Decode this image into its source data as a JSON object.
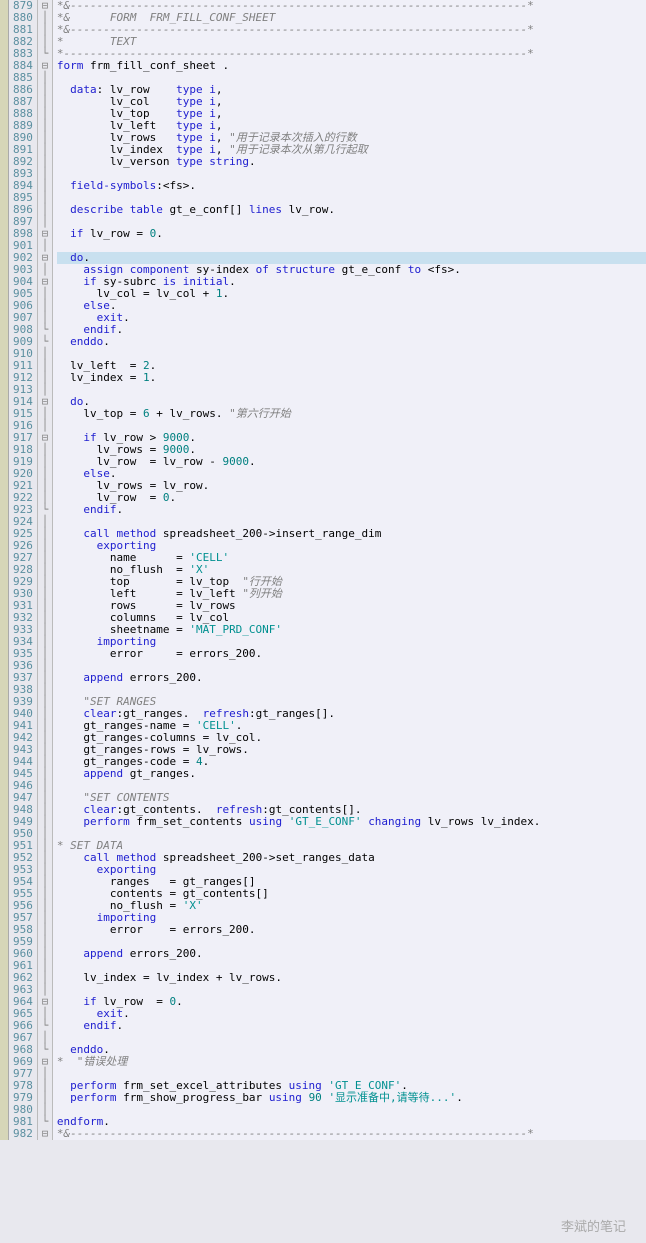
{
  "lines": [
    {
      "n": 879,
      "f": "⊟",
      "cls": "cmh",
      "t": "*&---------------------------------------------------------------------*"
    },
    {
      "n": 880,
      "f": "|",
      "cls": "cmh",
      "t": "*&      FORM  FRM_FILL_CONF_SHEET"
    },
    {
      "n": 881,
      "f": "|",
      "cls": "cmh",
      "t": "*&---------------------------------------------------------------------*"
    },
    {
      "n": 882,
      "f": "|",
      "cls": "cmh",
      "t": "*       TEXT"
    },
    {
      "n": 883,
      "f": "└",
      "cls": "cmh",
      "t": "*----------------------------------------------------------------------*"
    },
    {
      "n": 884,
      "f": "⊟",
      "seg": [
        {
          "c": "kw",
          "t": "form"
        },
        {
          "t": " frm_fill_conf_sheet ."
        }
      ]
    },
    {
      "n": 885,
      "f": "|",
      "t": ""
    },
    {
      "n": 886,
      "f": "|",
      "seg": [
        {
          "t": "  "
        },
        {
          "c": "kw",
          "t": "data"
        },
        {
          "t": ": lv_row    "
        },
        {
          "c": "ty",
          "t": "type i"
        },
        {
          "t": ","
        }
      ]
    },
    {
      "n": 887,
      "f": "|",
      "seg": [
        {
          "t": "        lv_col    "
        },
        {
          "c": "ty",
          "t": "type i"
        },
        {
          "t": ","
        }
      ]
    },
    {
      "n": 888,
      "f": "|",
      "seg": [
        {
          "t": "        lv_top    "
        },
        {
          "c": "ty",
          "t": "type i"
        },
        {
          "t": ","
        }
      ]
    },
    {
      "n": 889,
      "f": "|",
      "seg": [
        {
          "t": "        lv_left   "
        },
        {
          "c": "ty",
          "t": "type i"
        },
        {
          "t": ","
        }
      ]
    },
    {
      "n": 890,
      "f": "|",
      "seg": [
        {
          "t": "        lv_rows   "
        },
        {
          "c": "ty",
          "t": "type i"
        },
        {
          "t": ", "
        },
        {
          "c": "cm",
          "t": "\"用于记录本次插入的行数"
        }
      ]
    },
    {
      "n": 891,
      "f": "|",
      "seg": [
        {
          "t": "        lv_index  "
        },
        {
          "c": "ty",
          "t": "type i"
        },
        {
          "t": ", "
        },
        {
          "c": "cm",
          "t": "\"用于记录本次从第几行起取"
        }
      ]
    },
    {
      "n": 892,
      "f": "|",
      "seg": [
        {
          "t": "        lv_verson "
        },
        {
          "c": "ty",
          "t": "type string"
        },
        {
          "t": "."
        }
      ]
    },
    {
      "n": 893,
      "f": "|",
      "t": ""
    },
    {
      "n": 894,
      "f": "|",
      "seg": [
        {
          "t": "  "
        },
        {
          "c": "kw",
          "t": "field-symbols"
        },
        {
          "t": ":<fs>."
        }
      ]
    },
    {
      "n": 895,
      "f": "|",
      "t": ""
    },
    {
      "n": 896,
      "f": "|",
      "seg": [
        {
          "t": "  "
        },
        {
          "c": "kw",
          "t": "describe table"
        },
        {
          "t": " gt_e_conf[] "
        },
        {
          "c": "kw",
          "t": "lines"
        },
        {
          "t": " lv_row."
        }
      ]
    },
    {
      "n": 897,
      "f": "|",
      "t": ""
    },
    {
      "n": 898,
      "f": "⊟",
      "seg": [
        {
          "t": "  "
        },
        {
          "c": "kw",
          "t": "if"
        },
        {
          "t": " lv_row = "
        },
        {
          "c": "num",
          "t": "0"
        },
        {
          "t": "."
        }
      ]
    },
    {
      "n": 901,
      "f": "|",
      "t": ""
    },
    {
      "n": 902,
      "f": "⊟",
      "hl": true,
      "seg": [
        {
          "t": "  "
        },
        {
          "c": "kw",
          "t": "do"
        },
        {
          "t": "."
        }
      ]
    },
    {
      "n": 903,
      "f": "|",
      "seg": [
        {
          "t": "    "
        },
        {
          "c": "kw",
          "t": "assign component"
        },
        {
          "t": " sy-index "
        },
        {
          "c": "kw",
          "t": "of structure"
        },
        {
          "t": " gt_e_conf "
        },
        {
          "c": "kw",
          "t": "to"
        },
        {
          "t": " <fs>."
        }
      ]
    },
    {
      "n": 904,
      "f": "⊟",
      "seg": [
        {
          "t": "    "
        },
        {
          "c": "kw",
          "t": "if"
        },
        {
          "t": " sy-subrc "
        },
        {
          "c": "kw",
          "t": "is initial"
        },
        {
          "t": "."
        }
      ]
    },
    {
      "n": 905,
      "f": "|",
      "seg": [
        {
          "t": "      lv_col = lv_col + "
        },
        {
          "c": "num",
          "t": "1"
        },
        {
          "t": "."
        }
      ]
    },
    {
      "n": 906,
      "f": "|",
      "seg": [
        {
          "t": "    "
        },
        {
          "c": "kw",
          "t": "else"
        },
        {
          "t": "."
        }
      ]
    },
    {
      "n": 907,
      "f": "|",
      "seg": [
        {
          "t": "      "
        },
        {
          "c": "kw",
          "t": "exit"
        },
        {
          "t": "."
        }
      ]
    },
    {
      "n": 908,
      "f": "└",
      "seg": [
        {
          "t": "    "
        },
        {
          "c": "kw",
          "t": "endif"
        },
        {
          "t": "."
        }
      ]
    },
    {
      "n": 909,
      "f": "└",
      "seg": [
        {
          "t": "  "
        },
        {
          "c": "kw",
          "t": "enddo"
        },
        {
          "t": "."
        }
      ]
    },
    {
      "n": 910,
      "f": "|",
      "t": ""
    },
    {
      "n": 911,
      "f": "|",
      "seg": [
        {
          "t": "  lv_left  = "
        },
        {
          "c": "num",
          "t": "2"
        },
        {
          "t": "."
        }
      ]
    },
    {
      "n": 912,
      "f": "|",
      "seg": [
        {
          "t": "  lv_index = "
        },
        {
          "c": "num",
          "t": "1"
        },
        {
          "t": "."
        }
      ]
    },
    {
      "n": 913,
      "f": "|",
      "t": ""
    },
    {
      "n": 914,
      "f": "⊟",
      "seg": [
        {
          "t": "  "
        },
        {
          "c": "kw",
          "t": "do"
        },
        {
          "t": "."
        }
      ]
    },
    {
      "n": 915,
      "f": "|",
      "seg": [
        {
          "t": "    lv_top = "
        },
        {
          "c": "num",
          "t": "6"
        },
        {
          "t": " + lv_rows. "
        },
        {
          "c": "cm",
          "t": "\"第六行开始"
        }
      ]
    },
    {
      "n": 916,
      "f": "|",
      "t": ""
    },
    {
      "n": 917,
      "f": "⊟",
      "seg": [
        {
          "t": "    "
        },
        {
          "c": "kw",
          "t": "if"
        },
        {
          "t": " lv_row > "
        },
        {
          "c": "num",
          "t": "9000"
        },
        {
          "t": "."
        }
      ]
    },
    {
      "n": 918,
      "f": "|",
      "seg": [
        {
          "t": "      lv_rows = "
        },
        {
          "c": "num",
          "t": "9000"
        },
        {
          "t": "."
        }
      ]
    },
    {
      "n": 919,
      "f": "|",
      "seg": [
        {
          "t": "      lv_row  = lv_row - "
        },
        {
          "c": "num",
          "t": "9000"
        },
        {
          "t": "."
        }
      ]
    },
    {
      "n": 920,
      "f": "|",
      "seg": [
        {
          "t": "    "
        },
        {
          "c": "kw",
          "t": "else"
        },
        {
          "t": "."
        }
      ]
    },
    {
      "n": 921,
      "f": "|",
      "seg": [
        {
          "t": "      lv_rows = lv_row."
        }
      ]
    },
    {
      "n": 922,
      "f": "|",
      "seg": [
        {
          "t": "      lv_row  = "
        },
        {
          "c": "num",
          "t": "0"
        },
        {
          "t": "."
        }
      ]
    },
    {
      "n": 923,
      "f": "└",
      "seg": [
        {
          "t": "    "
        },
        {
          "c": "kw",
          "t": "endif"
        },
        {
          "t": "."
        }
      ]
    },
    {
      "n": 924,
      "f": "|",
      "t": ""
    },
    {
      "n": 925,
      "f": "|",
      "seg": [
        {
          "t": "    "
        },
        {
          "c": "kw",
          "t": "call method"
        },
        {
          "t": " spreadsheet_200->insert_range_dim"
        }
      ]
    },
    {
      "n": 926,
      "f": "|",
      "seg": [
        {
          "t": "      "
        },
        {
          "c": "kw",
          "t": "exporting"
        }
      ]
    },
    {
      "n": 927,
      "f": "|",
      "seg": [
        {
          "t": "        name      = "
        },
        {
          "c": "str",
          "t": "'CELL'"
        }
      ]
    },
    {
      "n": 928,
      "f": "|",
      "seg": [
        {
          "t": "        no_flush  = "
        },
        {
          "c": "str",
          "t": "'X'"
        }
      ]
    },
    {
      "n": 929,
      "f": "|",
      "seg": [
        {
          "t": "        top       = lv_top  "
        },
        {
          "c": "cm",
          "t": "\"行开始"
        }
      ]
    },
    {
      "n": 930,
      "f": "|",
      "seg": [
        {
          "t": "        left      = lv_left "
        },
        {
          "c": "cm",
          "t": "\"列开始"
        }
      ]
    },
    {
      "n": 931,
      "f": "|",
      "seg": [
        {
          "t": "        rows      = lv_rows"
        }
      ]
    },
    {
      "n": 932,
      "f": "|",
      "seg": [
        {
          "t": "        columns   = lv_col"
        }
      ]
    },
    {
      "n": 933,
      "f": "|",
      "seg": [
        {
          "t": "        sheetname = "
        },
        {
          "c": "str",
          "t": "'MAT_PRD_CONF'"
        }
      ]
    },
    {
      "n": 934,
      "f": "|",
      "seg": [
        {
          "t": "      "
        },
        {
          "c": "kw",
          "t": "importing"
        }
      ]
    },
    {
      "n": 935,
      "f": "|",
      "seg": [
        {
          "t": "        error     = errors_200."
        }
      ]
    },
    {
      "n": 936,
      "f": "|",
      "t": ""
    },
    {
      "n": 937,
      "f": "|",
      "seg": [
        {
          "t": "    "
        },
        {
          "c": "kw",
          "t": "append"
        },
        {
          "t": " errors_200."
        }
      ]
    },
    {
      "n": 938,
      "f": "|",
      "t": ""
    },
    {
      "n": 939,
      "f": "|",
      "seg": [
        {
          "t": "    "
        },
        {
          "c": "cm",
          "t": "\"SET RANGES"
        }
      ]
    },
    {
      "n": 940,
      "f": "|",
      "seg": [
        {
          "t": "    "
        },
        {
          "c": "kw",
          "t": "clear"
        },
        {
          "t": ":gt_ranges.  "
        },
        {
          "c": "kw",
          "t": "refresh"
        },
        {
          "t": ":gt_ranges[]."
        }
      ]
    },
    {
      "n": 941,
      "f": "|",
      "seg": [
        {
          "t": "    gt_ranges-name = "
        },
        {
          "c": "str",
          "t": "'CELL'"
        },
        {
          "t": "."
        }
      ]
    },
    {
      "n": 942,
      "f": "|",
      "seg": [
        {
          "t": "    gt_ranges-columns = lv_col."
        }
      ]
    },
    {
      "n": 943,
      "f": "|",
      "seg": [
        {
          "t": "    gt_ranges-rows = lv_rows."
        }
      ]
    },
    {
      "n": 944,
      "f": "|",
      "seg": [
        {
          "t": "    gt_ranges-code = "
        },
        {
          "c": "num",
          "t": "4"
        },
        {
          "t": "."
        }
      ]
    },
    {
      "n": 945,
      "f": "|",
      "seg": [
        {
          "t": "    "
        },
        {
          "c": "kw",
          "t": "append"
        },
        {
          "t": " gt_ranges."
        }
      ]
    },
    {
      "n": 946,
      "f": "|",
      "t": ""
    },
    {
      "n": 947,
      "f": "|",
      "seg": [
        {
          "t": "    "
        },
        {
          "c": "cm",
          "t": "\"SET CONTENTS"
        }
      ]
    },
    {
      "n": 948,
      "f": "|",
      "seg": [
        {
          "t": "    "
        },
        {
          "c": "kw",
          "t": "clear"
        },
        {
          "t": ":gt_contents.  "
        },
        {
          "c": "kw",
          "t": "refresh"
        },
        {
          "t": ":gt_contents[]."
        }
      ]
    },
    {
      "n": 949,
      "f": "|",
      "seg": [
        {
          "t": "    "
        },
        {
          "c": "kw",
          "t": "perform"
        },
        {
          "t": " frm_set_contents "
        },
        {
          "c": "kw",
          "t": "using"
        },
        {
          "t": " "
        },
        {
          "c": "str",
          "t": "'GT_E_CONF'"
        },
        {
          "t": " "
        },
        {
          "c": "kw",
          "t": "changing"
        },
        {
          "t": " lv_rows lv_index."
        }
      ]
    },
    {
      "n": 950,
      "f": "|",
      "t": ""
    },
    {
      "n": 951,
      "f": "|",
      "seg": [
        {
          "c": "cm",
          "t": "* SET DATA"
        }
      ]
    },
    {
      "n": 952,
      "f": "|",
      "seg": [
        {
          "t": "    "
        },
        {
          "c": "kw",
          "t": "call method"
        },
        {
          "t": " spreadsheet_200->set_ranges_data"
        }
      ]
    },
    {
      "n": 953,
      "f": "|",
      "seg": [
        {
          "t": "      "
        },
        {
          "c": "kw",
          "t": "exporting"
        }
      ]
    },
    {
      "n": 954,
      "f": "|",
      "seg": [
        {
          "t": "        ranges   = gt_ranges[]"
        }
      ]
    },
    {
      "n": 955,
      "f": "|",
      "seg": [
        {
          "t": "        contents = gt_contents[]"
        }
      ]
    },
    {
      "n": 956,
      "f": "|",
      "seg": [
        {
          "t": "        no_flush = "
        },
        {
          "c": "str",
          "t": "'X'"
        }
      ]
    },
    {
      "n": 957,
      "f": "|",
      "seg": [
        {
          "t": "      "
        },
        {
          "c": "kw",
          "t": "importing"
        }
      ]
    },
    {
      "n": 958,
      "f": "|",
      "seg": [
        {
          "t": "        error    = errors_200."
        }
      ]
    },
    {
      "n": 959,
      "f": "|",
      "t": ""
    },
    {
      "n": 960,
      "f": "|",
      "seg": [
        {
          "t": "    "
        },
        {
          "c": "kw",
          "t": "append"
        },
        {
          "t": " errors_200."
        }
      ]
    },
    {
      "n": 961,
      "f": "|",
      "t": ""
    },
    {
      "n": 962,
      "f": "|",
      "seg": [
        {
          "t": "    lv_index = lv_index + lv_rows."
        }
      ]
    },
    {
      "n": 963,
      "f": "|",
      "t": ""
    },
    {
      "n": 964,
      "f": "⊟",
      "seg": [
        {
          "t": "    "
        },
        {
          "c": "kw",
          "t": "if"
        },
        {
          "t": " lv_row  = "
        },
        {
          "c": "num",
          "t": "0"
        },
        {
          "t": "."
        }
      ]
    },
    {
      "n": 965,
      "f": "|",
      "seg": [
        {
          "t": "      "
        },
        {
          "c": "kw",
          "t": "exit"
        },
        {
          "t": "."
        }
      ]
    },
    {
      "n": 966,
      "f": "└",
      "seg": [
        {
          "t": "    "
        },
        {
          "c": "kw",
          "t": "endif"
        },
        {
          "t": "."
        }
      ]
    },
    {
      "n": 967,
      "f": "|",
      "t": ""
    },
    {
      "n": 968,
      "f": "└",
      "seg": [
        {
          "t": "  "
        },
        {
          "c": "kw",
          "t": "enddo"
        },
        {
          "t": "."
        }
      ]
    },
    {
      "n": 969,
      "f": "⊟",
      "seg": [
        {
          "c": "cm",
          "t": "*  \"错误处理"
        }
      ]
    },
    {
      "n": 977,
      "f": "|",
      "t": ""
    },
    {
      "n": 978,
      "f": "|",
      "seg": [
        {
          "t": "  "
        },
        {
          "c": "kw",
          "t": "perform"
        },
        {
          "t": " frm_set_excel_attributes "
        },
        {
          "c": "kw",
          "t": "using"
        },
        {
          "t": " "
        },
        {
          "c": "str",
          "t": "'GT_E_CONF'"
        },
        {
          "t": "."
        }
      ]
    },
    {
      "n": 979,
      "f": "|",
      "seg": [
        {
          "t": "  "
        },
        {
          "c": "kw",
          "t": "perform"
        },
        {
          "t": " frm_show_progress_bar "
        },
        {
          "c": "kw",
          "t": "using"
        },
        {
          "t": " "
        },
        {
          "c": "num",
          "t": "90"
        },
        {
          "t": " "
        },
        {
          "c": "str",
          "t": "'显示准备中,请等待...'"
        },
        {
          "t": "."
        }
      ]
    },
    {
      "n": 980,
      "f": "|",
      "t": ""
    },
    {
      "n": 981,
      "f": "└",
      "seg": [
        {
          "c": "kw",
          "t": "endform"
        },
        {
          "t": "."
        }
      ]
    },
    {
      "n": 982,
      "f": "⊟",
      "cls": "cmh",
      "t": "*&---------------------------------------------------------------------*"
    }
  ],
  "watermark": "李斌的笔记"
}
